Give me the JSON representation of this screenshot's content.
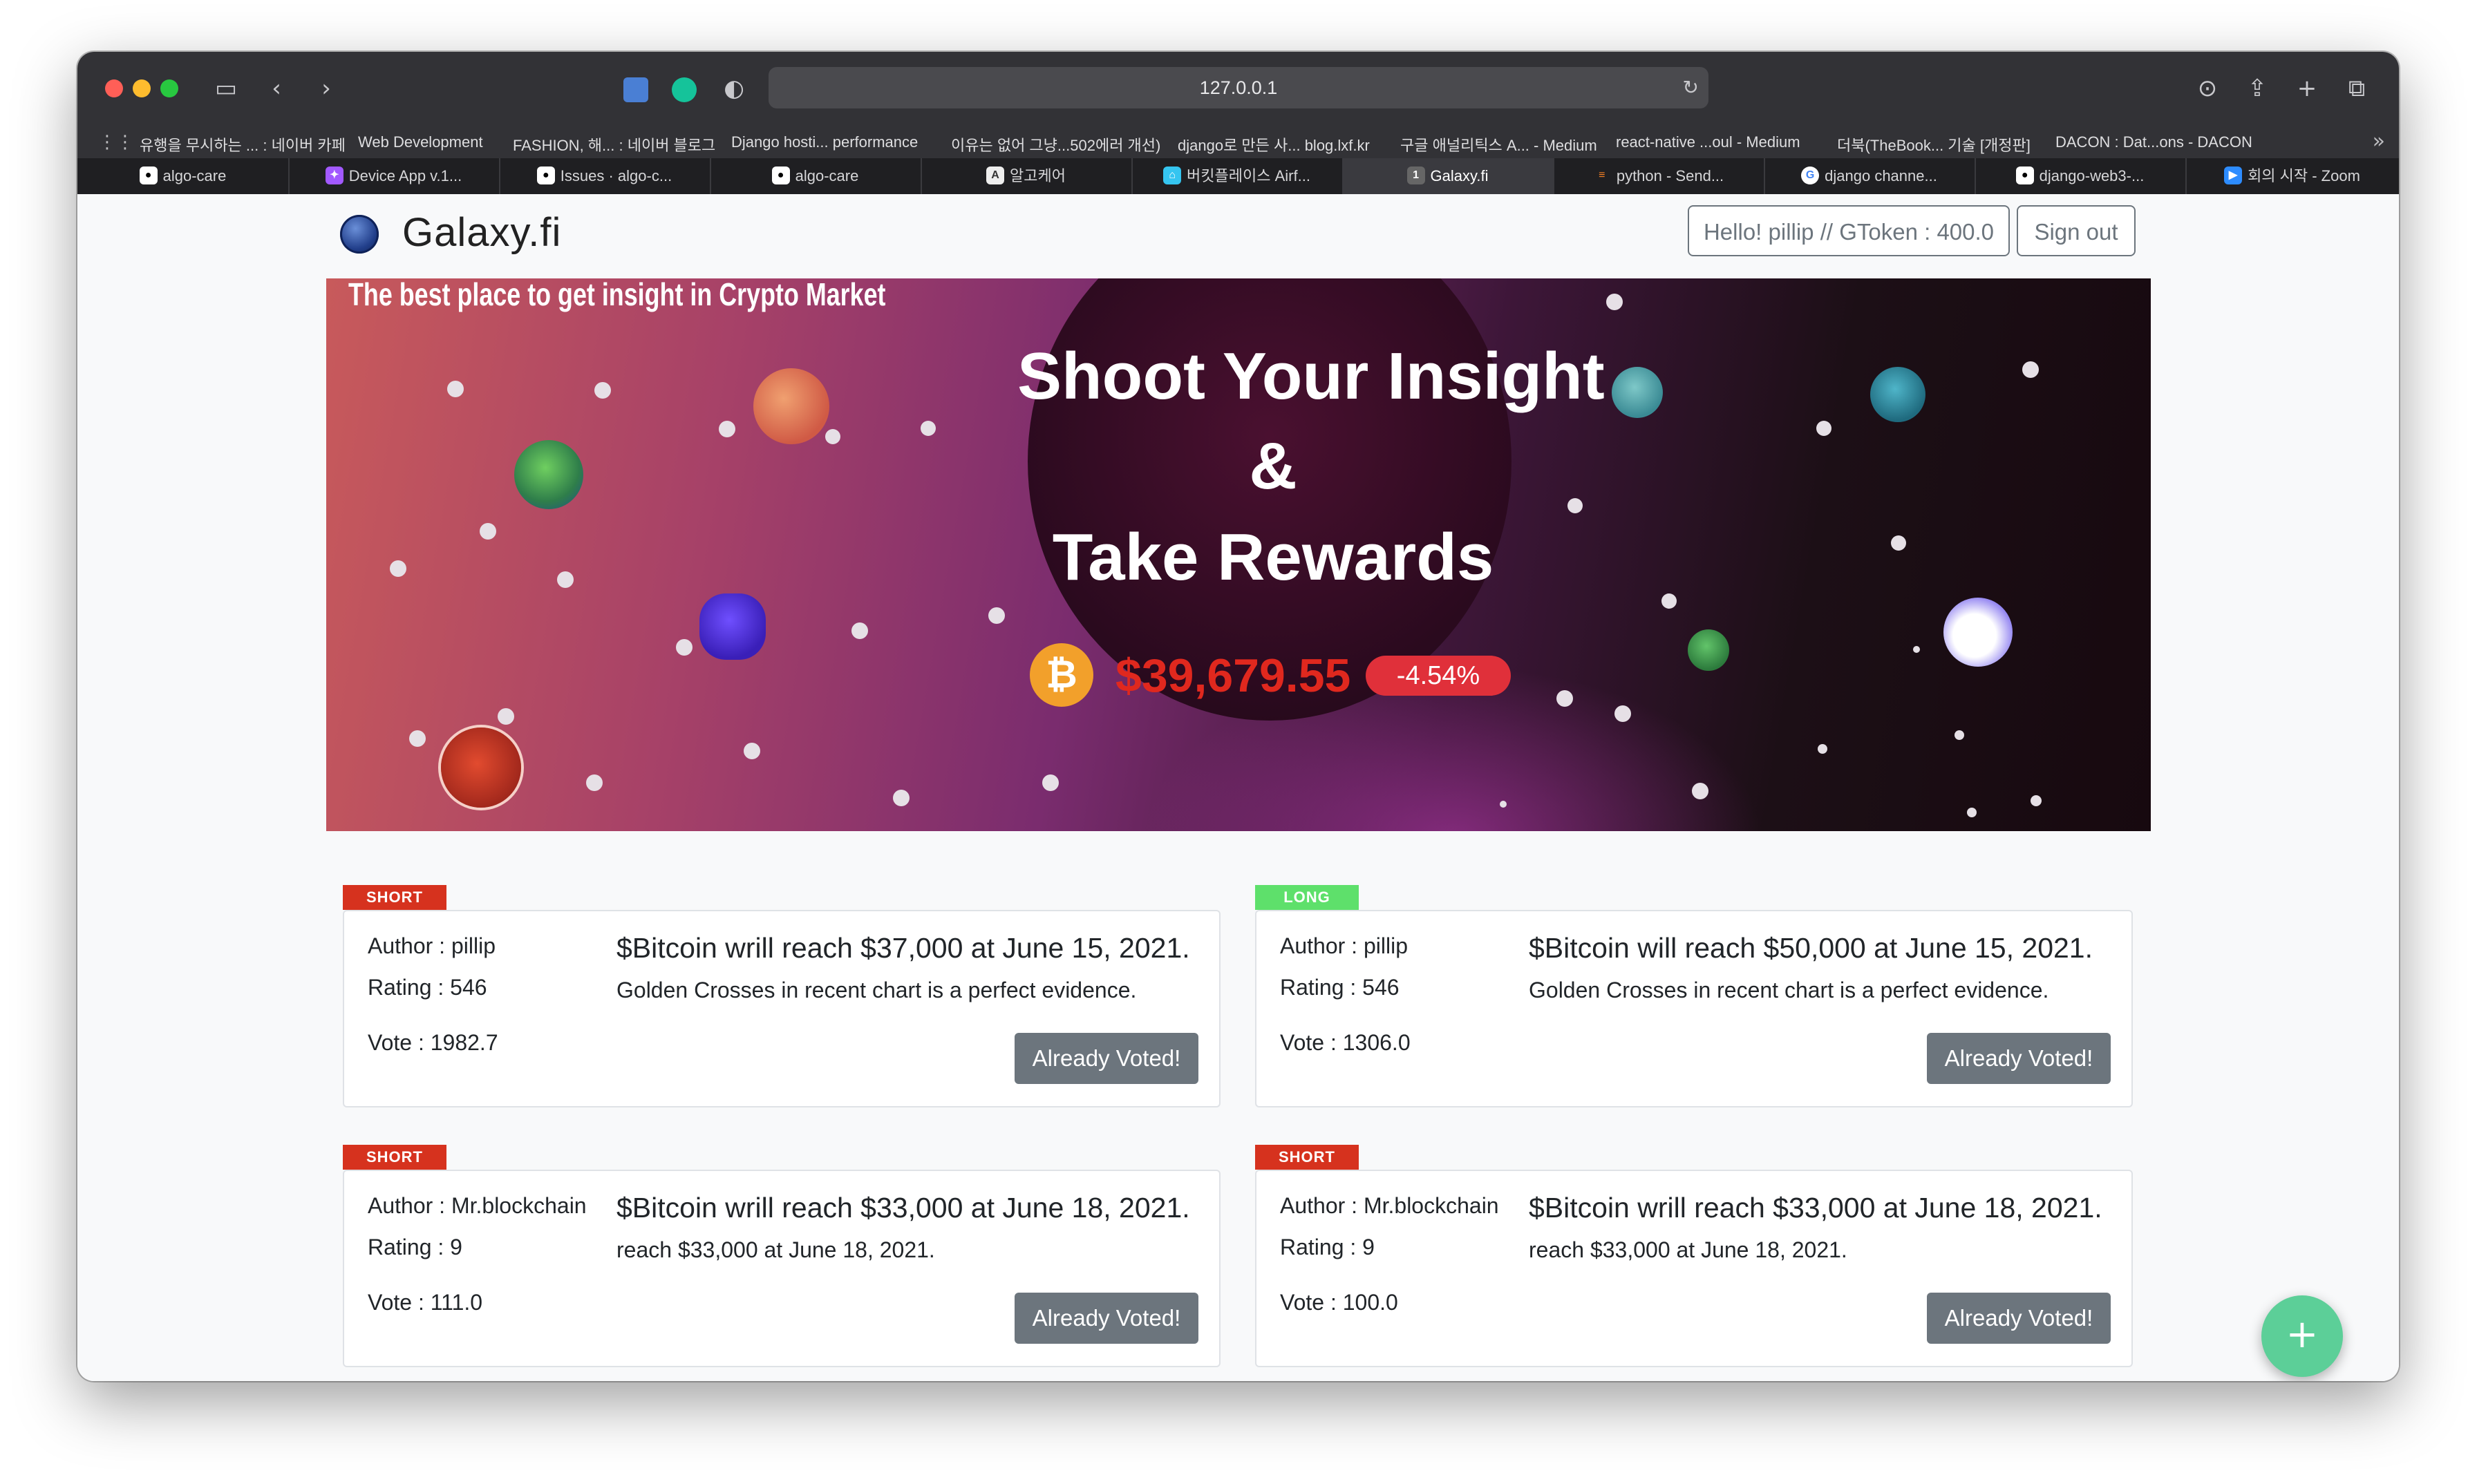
{
  "browser": {
    "url": "127.0.0.1",
    "bookmarks": [
      "유행을 무시하는 ... : 네이버 카페",
      "Web Development",
      "FASHION, 해... : 네이버 블로그",
      "Django hosti... performance",
      "이유는 없어 그냥...502에러 개선)",
      "django로 만든 사... blog.lxf.kr",
      "구글 애널리틱스 A... - Medium",
      "react-native ...oul - Medium",
      "더북(TheBook... 기술 [개정판]",
      "DACON : Dat...ons - DACON"
    ],
    "tabs": [
      "algo-care",
      "Device App v.1...",
      "Issues · algo-c...",
      "algo-care",
      "알고케어",
      "버킷플레이스 Airf...",
      "Galaxy.fi",
      "python - Send...",
      "django channe...",
      "django-web3-...",
      "회의 시작 - Zoom"
    ],
    "active_tab_number": "1"
  },
  "header": {
    "brand": "Galaxy.fi",
    "greeting": "Hello! pillip // GToken : 400.0",
    "sign_out": "Sign out"
  },
  "hero": {
    "tagline": "The best place to get insight in Crypto Market",
    "title_line1": "Shoot Your Insight",
    "title_line2": "&",
    "title_line3": "Take Rewards",
    "btc_symbol": "₿",
    "btc_price": "$39,679.55",
    "btc_change": "-4.54%"
  },
  "cards": [
    {
      "badge": "SHORT",
      "author": "Author : pillip",
      "rating": "Rating : 546",
      "vote": "Vote : 1982.7",
      "title": "$Bitcoin wrill reach $37,000 at June 15, 2021.",
      "description": "Golden Crosses in recent chart is a perfect evidence.",
      "button": "Already Voted!"
    },
    {
      "badge": "LONG",
      "author": "Author : pillip",
      "rating": "Rating : 546",
      "vote": "Vote : 1306.0",
      "title": "$Bitcoin will reach $50,000 at June 15, 2021.",
      "description": "Golden Crosses in recent chart is a perfect evidence.",
      "button": "Already Voted!"
    },
    {
      "badge": "SHORT",
      "author": "Author : Mr.blockchain",
      "rating": "Rating : 9",
      "vote": "Vote : 111.0",
      "title": "$Bitcoin wrill reach $33,000 at June 18, 2021.",
      "description": "reach $33,000 at June 18, 2021.",
      "button": "Already Voted!"
    },
    {
      "badge": "SHORT",
      "author": "Author : Mr.blockchain",
      "rating": "Rating : 9",
      "vote": "Vote : 100.0",
      "title": "$Bitcoin wrill reach $33,000 at June 18, 2021.",
      "description": "reach $33,000 at June 18, 2021.",
      "button": "Already Voted!"
    }
  ],
  "fab_label": "+",
  "colors": {
    "short_badge": "#d6321e",
    "long_badge": "#5ee06b",
    "btc_price": "#e0281e",
    "voted_button": "#6c757d",
    "fab": "#5ccf98"
  }
}
